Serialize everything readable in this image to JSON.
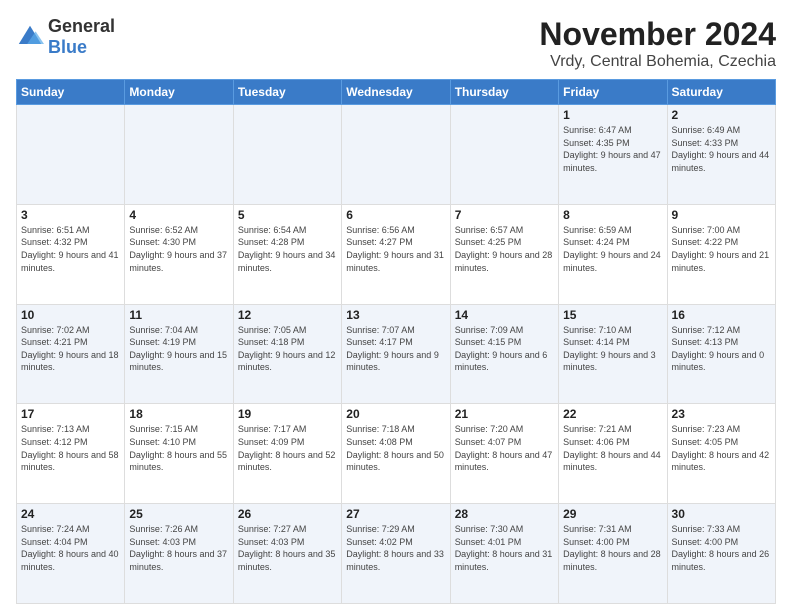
{
  "logo": {
    "general": "General",
    "blue": "Blue"
  },
  "header": {
    "month": "November 2024",
    "location": "Vrdy, Central Bohemia, Czechia"
  },
  "weekdays": [
    "Sunday",
    "Monday",
    "Tuesday",
    "Wednesday",
    "Thursday",
    "Friday",
    "Saturday"
  ],
  "weeks": [
    [
      {
        "day": "",
        "info": ""
      },
      {
        "day": "",
        "info": ""
      },
      {
        "day": "",
        "info": ""
      },
      {
        "day": "",
        "info": ""
      },
      {
        "day": "",
        "info": ""
      },
      {
        "day": "1",
        "info": "Sunrise: 6:47 AM\nSunset: 4:35 PM\nDaylight: 9 hours and 47 minutes."
      },
      {
        "day": "2",
        "info": "Sunrise: 6:49 AM\nSunset: 4:33 PM\nDaylight: 9 hours and 44 minutes."
      }
    ],
    [
      {
        "day": "3",
        "info": "Sunrise: 6:51 AM\nSunset: 4:32 PM\nDaylight: 9 hours and 41 minutes."
      },
      {
        "day": "4",
        "info": "Sunrise: 6:52 AM\nSunset: 4:30 PM\nDaylight: 9 hours and 37 minutes."
      },
      {
        "day": "5",
        "info": "Sunrise: 6:54 AM\nSunset: 4:28 PM\nDaylight: 9 hours and 34 minutes."
      },
      {
        "day": "6",
        "info": "Sunrise: 6:56 AM\nSunset: 4:27 PM\nDaylight: 9 hours and 31 minutes."
      },
      {
        "day": "7",
        "info": "Sunrise: 6:57 AM\nSunset: 4:25 PM\nDaylight: 9 hours and 28 minutes."
      },
      {
        "day": "8",
        "info": "Sunrise: 6:59 AM\nSunset: 4:24 PM\nDaylight: 9 hours and 24 minutes."
      },
      {
        "day": "9",
        "info": "Sunrise: 7:00 AM\nSunset: 4:22 PM\nDaylight: 9 hours and 21 minutes."
      }
    ],
    [
      {
        "day": "10",
        "info": "Sunrise: 7:02 AM\nSunset: 4:21 PM\nDaylight: 9 hours and 18 minutes."
      },
      {
        "day": "11",
        "info": "Sunrise: 7:04 AM\nSunset: 4:19 PM\nDaylight: 9 hours and 15 minutes."
      },
      {
        "day": "12",
        "info": "Sunrise: 7:05 AM\nSunset: 4:18 PM\nDaylight: 9 hours and 12 minutes."
      },
      {
        "day": "13",
        "info": "Sunrise: 7:07 AM\nSunset: 4:17 PM\nDaylight: 9 hours and 9 minutes."
      },
      {
        "day": "14",
        "info": "Sunrise: 7:09 AM\nSunset: 4:15 PM\nDaylight: 9 hours and 6 minutes."
      },
      {
        "day": "15",
        "info": "Sunrise: 7:10 AM\nSunset: 4:14 PM\nDaylight: 9 hours and 3 minutes."
      },
      {
        "day": "16",
        "info": "Sunrise: 7:12 AM\nSunset: 4:13 PM\nDaylight: 9 hours and 0 minutes."
      }
    ],
    [
      {
        "day": "17",
        "info": "Sunrise: 7:13 AM\nSunset: 4:12 PM\nDaylight: 8 hours and 58 minutes."
      },
      {
        "day": "18",
        "info": "Sunrise: 7:15 AM\nSunset: 4:10 PM\nDaylight: 8 hours and 55 minutes."
      },
      {
        "day": "19",
        "info": "Sunrise: 7:17 AM\nSunset: 4:09 PM\nDaylight: 8 hours and 52 minutes."
      },
      {
        "day": "20",
        "info": "Sunrise: 7:18 AM\nSunset: 4:08 PM\nDaylight: 8 hours and 50 minutes."
      },
      {
        "day": "21",
        "info": "Sunrise: 7:20 AM\nSunset: 4:07 PM\nDaylight: 8 hours and 47 minutes."
      },
      {
        "day": "22",
        "info": "Sunrise: 7:21 AM\nSunset: 4:06 PM\nDaylight: 8 hours and 44 minutes."
      },
      {
        "day": "23",
        "info": "Sunrise: 7:23 AM\nSunset: 4:05 PM\nDaylight: 8 hours and 42 minutes."
      }
    ],
    [
      {
        "day": "24",
        "info": "Sunrise: 7:24 AM\nSunset: 4:04 PM\nDaylight: 8 hours and 40 minutes."
      },
      {
        "day": "25",
        "info": "Sunrise: 7:26 AM\nSunset: 4:03 PM\nDaylight: 8 hours and 37 minutes."
      },
      {
        "day": "26",
        "info": "Sunrise: 7:27 AM\nSunset: 4:03 PM\nDaylight: 8 hours and 35 minutes."
      },
      {
        "day": "27",
        "info": "Sunrise: 7:29 AM\nSunset: 4:02 PM\nDaylight: 8 hours and 33 minutes."
      },
      {
        "day": "28",
        "info": "Sunrise: 7:30 AM\nSunset: 4:01 PM\nDaylight: 8 hours and 31 minutes."
      },
      {
        "day": "29",
        "info": "Sunrise: 7:31 AM\nSunset: 4:00 PM\nDaylight: 8 hours and 28 minutes."
      },
      {
        "day": "30",
        "info": "Sunrise: 7:33 AM\nSunset: 4:00 PM\nDaylight: 8 hours and 26 minutes."
      }
    ]
  ]
}
